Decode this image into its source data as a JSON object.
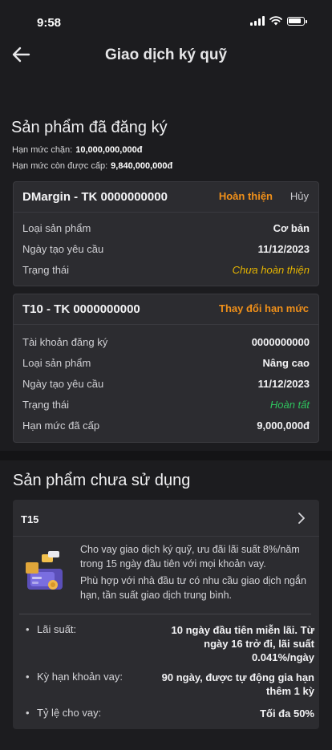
{
  "status": {
    "time": "9:58"
  },
  "nav": {
    "title": "Giao dịch ký quỹ"
  },
  "registered": {
    "title": "Sản phẩm đã đăng ký",
    "limit_label": "Hạn mức chặn:",
    "limit_value": "10,000,000,000đ",
    "remaining_label": "Hạn mức còn được cấp:",
    "remaining_value": "9,840,000,000đ",
    "cards": [
      {
        "title": "DMargin - TK 0000000000",
        "action_primary": "Hoàn thiện",
        "action_secondary": "Hủy",
        "rows": [
          {
            "label": "Loại sản phẩm",
            "value": "Cơ bản"
          },
          {
            "label": "Ngày tạo yêu cầu",
            "value": "11/12/2023"
          },
          {
            "label": "Trạng thái",
            "value": "Chưa hoàn thiện"
          }
        ]
      },
      {
        "title": "T10 - TK 0000000000",
        "action_primary": "Thay đổi hạn mức",
        "rows": [
          {
            "label": "Tài khoản đăng ký",
            "value": "0000000000"
          },
          {
            "label": "Loại sản phẩm",
            "value": "Nâng cao"
          },
          {
            "label": "Ngày tạo yêu cầu",
            "value": "11/12/2023"
          },
          {
            "label": "Trạng thái",
            "value": "Hoàn tất"
          },
          {
            "label": "Hạn mức đã cấp",
            "value": "9,000,000đ"
          }
        ]
      }
    ]
  },
  "unused": {
    "title": "Sản phẩm chưa sử dụng",
    "product": {
      "title": "T15",
      "desc1": "Cho vay giao dịch ký quỹ, ưu đãi lãi suất 8%/năm trong 15 ngày đầu tiên với mọi khoản vay.",
      "desc2": "Phù hợp với nhà đầu tư có nhu cầu giao dịch ngắn hạn, tần suất giao dịch trung bình.",
      "features": [
        {
          "label": "Lãi suất:",
          "value": "10 ngày đầu tiên miễn lãi. Từ ngày 16 trở đi, lãi suất 0.041%/ngày"
        },
        {
          "label": "Kỳ hạn khoản vay:",
          "value": "90 ngày, được tự động gia hạn thêm 1 kỳ"
        },
        {
          "label": "Tỷ lệ cho vay:",
          "value": "Tối đa 50%"
        }
      ]
    }
  },
  "colors": {
    "accent": "#f0901a",
    "pending": "#e6b500",
    "done": "#2ec55e",
    "background": "#1c1c1f",
    "card": "#2c2c30"
  },
  "icons": [
    "back-arrow-icon",
    "chevron-right-icon",
    "signal-icon",
    "wifi-icon",
    "battery-icon",
    "margin-product-illustration"
  ]
}
